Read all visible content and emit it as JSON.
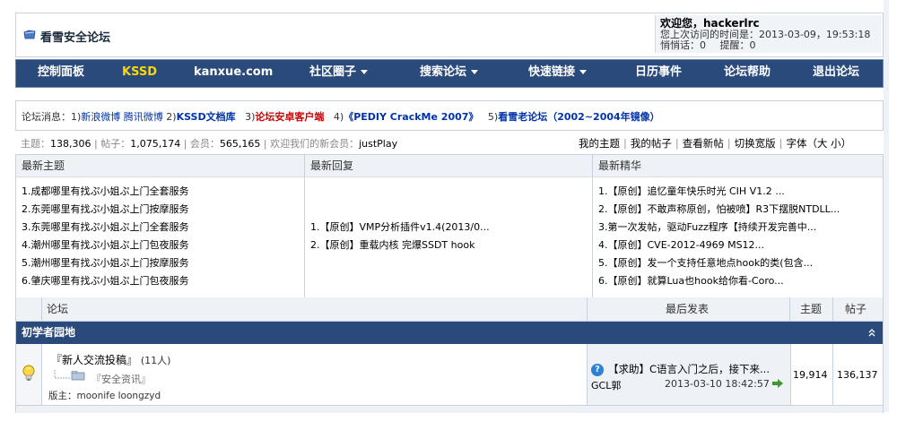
{
  "header": {
    "site_title": "看雪安全论坛",
    "welcome_label": "欢迎您，",
    "username": "hackerlrc",
    "last_visit_label": "您上次访问的时间是：",
    "last_visit_time": "2013-03-09，19:53:18",
    "pm_label": "悄悄话：",
    "pm_count": "0",
    "remind_label": "提醒：",
    "remind_count": "0"
  },
  "nav": {
    "items": [
      {
        "label": "控制面板"
      },
      {
        "label": "KSSD"
      },
      {
        "label": "kanxue.com"
      },
      {
        "label": "社区圈子"
      },
      {
        "label": "搜索论坛"
      },
      {
        "label": "快速链接"
      },
      {
        "label": "日历事件"
      },
      {
        "label": "论坛帮助"
      },
      {
        "label": "退出论坛"
      }
    ]
  },
  "news": {
    "prefix": "论坛消息：",
    "n1": "1)",
    "sina": "新浪微博",
    "tencent": "腾讯微博",
    "n2": "2)",
    "kssd_lib": "KSSD文档库",
    "n3": "3)",
    "android": "论坛安卓客户端",
    "n4": "4)",
    "crackme": "《PEDIY CrackMe 2007》",
    "n5": "5)",
    "old_forum": "看雪老论坛（2002~2004年镜像）"
  },
  "stats": {
    "topics_label": "主题：",
    "topics": "138,306",
    "posts_label": "帖子：",
    "posts": "1,075,174",
    "members_label": "会员：",
    "members": "565,165",
    "welcome_new": "欢迎我们的新会员：",
    "new_member": "justPlay"
  },
  "user_links": [
    {
      "label": "我的主题"
    },
    {
      "label": "我的帖子"
    },
    {
      "label": "查看新帖"
    },
    {
      "label": "切换宽版"
    },
    {
      "label": "字体（大 小）"
    }
  ],
  "latest": {
    "topics_header": "最新主题",
    "replies_header": "最新回复",
    "featured_header": "最新精华",
    "topics": [
      "1.成都哪里有找ぷ小姐ぷ上门全套服务",
      "2.东莞哪里有找ぷ小姐ぷ上门按摩服务",
      "3.东莞哪里有找ぷ小姐ぷ上门全套服务",
      "4.潮州哪里有找ぷ小姐ぷ上门包夜服务",
      "5.潮州哪里有找ぷ小姐ぷ上门按摩服务",
      "6.肇庆哪里有找ぷ小姐ぷ上门包夜服务"
    ],
    "replies": [
      "1.【原创】VMP分析插件v1.4(2013/0...",
      "2.【原创】重载内核 完爆SSDT hook"
    ],
    "featured": [
      "1.【原创】追忆童年快乐时光 CIH V1.2 ...",
      "2.【原创】不敢声称原创，怕被喷】R3下摆脱NTDLL...",
      "3.第一次发帖，驱动Fuzz程序【持续开发完善中...",
      "4.【原创】CVE-2012-4969 MS12...",
      "5.【原创】发一个支持任意地点hook的类(包含...",
      "6.【原创】就算Lua也hook给你看-Coro..."
    ]
  },
  "forum": {
    "col_forum": "论坛",
    "col_last_post": "最后发表",
    "col_topics": "主题",
    "col_posts": "帖子",
    "section_title": "初学者园地",
    "row": {
      "name": "『新人交流投稿』",
      "online": "(11人)",
      "subforum": "『安全资讯』",
      "moderators_label": "版主：",
      "moderators": "moonife loongzyd",
      "last_title": "【求助】C语言入门之后，接下来...",
      "last_author": "GCL郭",
      "last_time": "2013-03-10 18:42:57",
      "topics": "19,914",
      "posts": "136,137"
    }
  }
}
